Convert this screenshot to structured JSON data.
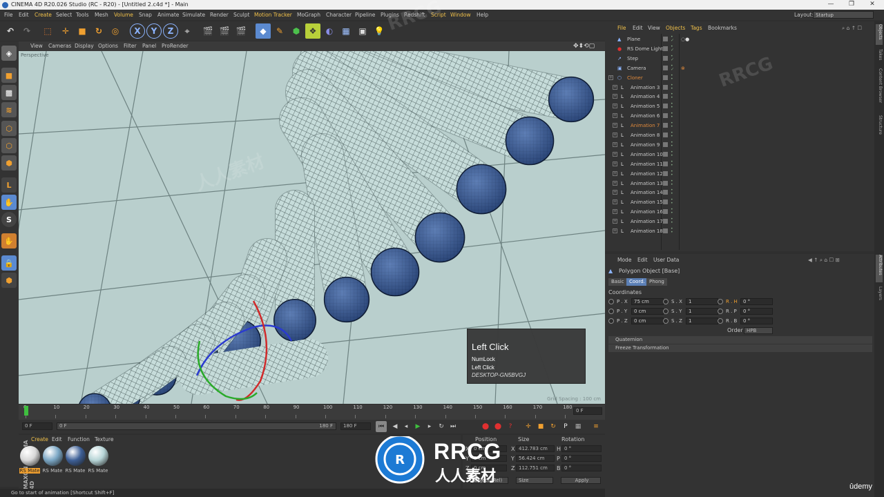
{
  "window": {
    "title": "CINEMA 4D R20.026 Studio (RC - R20) - [Untitled 2.c4d *] - Main",
    "minimize": "—",
    "maximize": "❐",
    "close": "✕"
  },
  "menubar": {
    "items": [
      "File",
      "Edit",
      "Create",
      "Select",
      "Tools",
      "Mesh",
      "Volume",
      "Snap",
      "Animate",
      "Simulate",
      "Render",
      "Sculpt",
      "Motion Tracker",
      "MoGraph",
      "Character",
      "Pipeline",
      "Plugins",
      "Redshift",
      "Script",
      "Window",
      "Help"
    ],
    "layout_label": "Layout:",
    "layout_value": "Startup"
  },
  "toolbar": {
    "axis_x": "X",
    "axis_y": "Y",
    "axis_z": "Z"
  },
  "viewport": {
    "menu": [
      "View",
      "Cameras",
      "Display",
      "Options",
      "Filter",
      "Panel",
      "ProRender"
    ],
    "label": "Perspective",
    "grid_spacing": "Grid Spacing : 100 cm",
    "bg_color": "#b9cfcd",
    "mesh_color": "#c6dcda",
    "ball_color": "#3d5f96"
  },
  "tooltip": {
    "title": "Left Click",
    "line1": "NumLock",
    "line2": "Left Click",
    "pc": "DESKTOP-GN5BVGJ"
  },
  "timeline": {
    "ticks": [
      "0",
      "10",
      "20",
      "30",
      "40",
      "50",
      "60",
      "70",
      "80",
      "90",
      "100",
      "110",
      "120",
      "130",
      "140",
      "150",
      "160",
      "170",
      "180"
    ],
    "current_frame": "0 F",
    "end_frame_box": "0 F",
    "start_field": "0 F",
    "range_start": "0 F",
    "range_end": "180 F",
    "end_field": "180 F"
  },
  "material_manager": {
    "menu": [
      "Create",
      "Edit",
      "Function",
      "Texture"
    ],
    "materials": [
      {
        "label": "RS Mate",
        "color": "#d8d8d8"
      },
      {
        "label": "RS Mate",
        "color": "#7aa6c4"
      },
      {
        "label": "RS Mate",
        "color": "#3d5f96"
      },
      {
        "label": "RS Mate",
        "color": "#b6d4d6"
      }
    ],
    "brand": "MAXON CINEMA 4D"
  },
  "coordinates_manager": {
    "headers": [
      "Position",
      "Size",
      "Rotation"
    ],
    "rows": [
      {
        "pos_label": "X",
        "pos": "0 cm",
        "size_label": "X",
        "size": "412.783 cm",
        "rot_label": "H",
        "rot": "0 °"
      },
      {
        "pos_label": "Y",
        "pos": "0 cm",
        "size_label": "Y",
        "size": "56.424 cm",
        "rot_label": "P",
        "rot": "0 °"
      },
      {
        "pos_label": "Z",
        "pos": "0 cm",
        "size_label": "Z",
        "size": "112.751 cm",
        "rot_label": "B",
        "rot": "0 °"
      }
    ],
    "mode": "Object (Rel)",
    "size_mode": "Size",
    "apply": "Apply"
  },
  "statusbar": "Go to start of animation [Shortcut Shift+F]",
  "object_manager": {
    "menu": [
      "File",
      "Edit",
      "View",
      "Objects",
      "Tags",
      "Bookmarks"
    ],
    "objects": [
      {
        "name": "Plane",
        "icon": "▲",
        "color": "#c8c8c8"
      },
      {
        "name": "RS Dome Light",
        "icon": "●",
        "color": "#c8c8c8"
      },
      {
        "name": "Step",
        "icon": "↗",
        "color": "#c8c8c8"
      },
      {
        "name": "Camera",
        "icon": "▣",
        "color": "#c8c8c8"
      },
      {
        "name": "Cloner",
        "icon": "⬡",
        "color": "#e08a3c"
      },
      {
        "name": "Animation 3",
        "icon": "L",
        "color": "#c8c8c8"
      },
      {
        "name": "Animation 4",
        "icon": "L",
        "color": "#c8c8c8"
      },
      {
        "name": "Animation 5",
        "icon": "L",
        "color": "#c8c8c8"
      },
      {
        "name": "Animation 6",
        "icon": "L",
        "color": "#c8c8c8"
      },
      {
        "name": "Animation 7",
        "icon": "L",
        "color": "#e08a3c"
      },
      {
        "name": "Animation 8",
        "icon": "L",
        "color": "#c8c8c8"
      },
      {
        "name": "Animation 9",
        "icon": "L",
        "color": "#c8c8c8"
      },
      {
        "name": "Animation 10",
        "icon": "L",
        "color": "#c8c8c8"
      },
      {
        "name": "Animation 11",
        "icon": "L",
        "color": "#c8c8c8"
      },
      {
        "name": "Animation 12",
        "icon": "L",
        "color": "#c8c8c8"
      },
      {
        "name": "Animation 13",
        "icon": "L",
        "color": "#c8c8c8"
      },
      {
        "name": "Animation 14",
        "icon": "L",
        "color": "#c8c8c8"
      },
      {
        "name": "Animation 15",
        "icon": "L",
        "color": "#c8c8c8"
      },
      {
        "name": "Animation 16",
        "icon": "L",
        "color": "#c8c8c8"
      },
      {
        "name": "Animation 17",
        "icon": "L",
        "color": "#c8c8c8"
      },
      {
        "name": "Animation 18",
        "icon": "L",
        "color": "#c8c8c8"
      }
    ]
  },
  "attributes": {
    "menu": [
      "Mode",
      "Edit",
      "User Data"
    ],
    "object_title": "Polygon Object [Base]",
    "tabs": [
      "Basic",
      "Coord.",
      "Phong"
    ],
    "section": "Coordinates",
    "rows": [
      {
        "p_label": "P . X",
        "p": "75 cm",
        "s_label": "S . X",
        "s": "1",
        "r_label": "R . H",
        "r": "0 °"
      },
      {
        "p_label": "P . Y",
        "p": "0 cm",
        "s_label": "S . Y",
        "s": "1",
        "r_label": "R . P",
        "r": "0 °"
      },
      {
        "p_label": "P . Z",
        "p": "0 cm",
        "s_label": "S . Z",
        "s": "1",
        "r_label": "R . B",
        "r": "0 °"
      }
    ],
    "order_label": "Order",
    "order_value": "HPB",
    "collapsed": [
      "Quaternion",
      "Freeze Transformation"
    ]
  },
  "right_tabs": [
    "Objects",
    "Takes",
    "Content Browser",
    "Structure",
    "Attributes",
    "Layers"
  ],
  "watermark": {
    "rrcg": "RRCG",
    "cn": "人人素材",
    "udemy": "ûdemy"
  }
}
